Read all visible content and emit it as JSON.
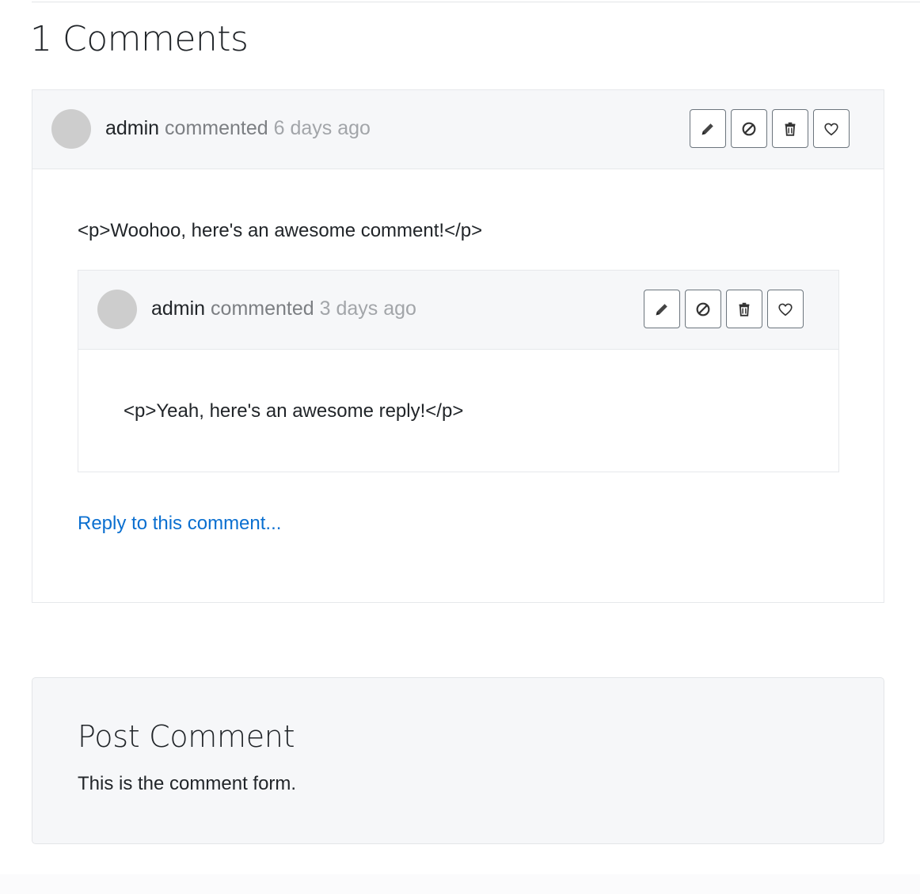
{
  "comments_section": {
    "title": "1 Comments",
    "comments": [
      {
        "author": "admin",
        "verb": "commented",
        "time": "6 days ago",
        "body": "<p>Woohoo, here's an awesome comment!</p>",
        "reply_link": "Reply to this comment...",
        "replies": [
          {
            "author": "admin",
            "verb": "commented",
            "time": "3 days ago",
            "body": "<p>Yeah, here's an awesome reply!</p>"
          }
        ]
      }
    ],
    "action_icons": [
      "pencil-icon",
      "ban-icon",
      "trash-icon",
      "heart-icon"
    ]
  },
  "post_comment": {
    "title": "Post Comment",
    "description": "This is the comment form."
  },
  "colors": {
    "header_bg": "#f6f7f9",
    "avatar": "#cdcdcd",
    "link": "#0a6fd0",
    "muted_time": "#a2a5a9"
  }
}
